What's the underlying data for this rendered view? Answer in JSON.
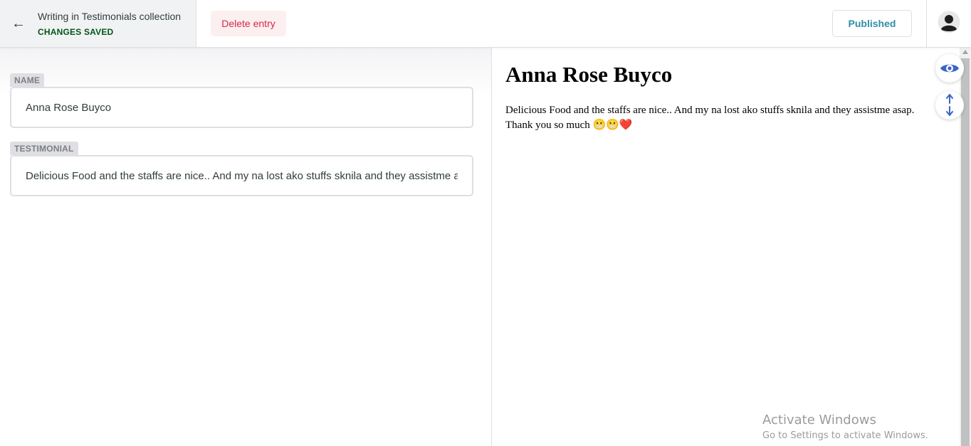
{
  "header": {
    "collection_title": "Writing in Testimonials collection",
    "save_status": "CHANGES SAVED",
    "delete_label": "Delete entry",
    "status_label": "Published",
    "back_icon": "←"
  },
  "editor": {
    "fields": [
      {
        "label": "NAME",
        "value": "Anna Rose Buyco"
      },
      {
        "label": "TESTIMONIAL",
        "value": "Delicious Food and the staffs are nice.. And my na lost ako stuffs sknila and they assistme asap. Thank you so much 😬😬❤️"
      }
    ]
  },
  "preview": {
    "title": "Anna Rose Buyco",
    "body": "Delicious Food and the staffs are nice.. And my na lost ako stuffs sknila and they assistme asap.\nThank you so much 😬😬❤️"
  },
  "watermark": {
    "title": "Activate Windows",
    "subtitle": "Go to Settings to activate Windows."
  },
  "colors": {
    "accent": "#2d8fa8",
    "saved": "#005614",
    "danger": "#d6284a",
    "float_icon": "#3a65c4"
  }
}
